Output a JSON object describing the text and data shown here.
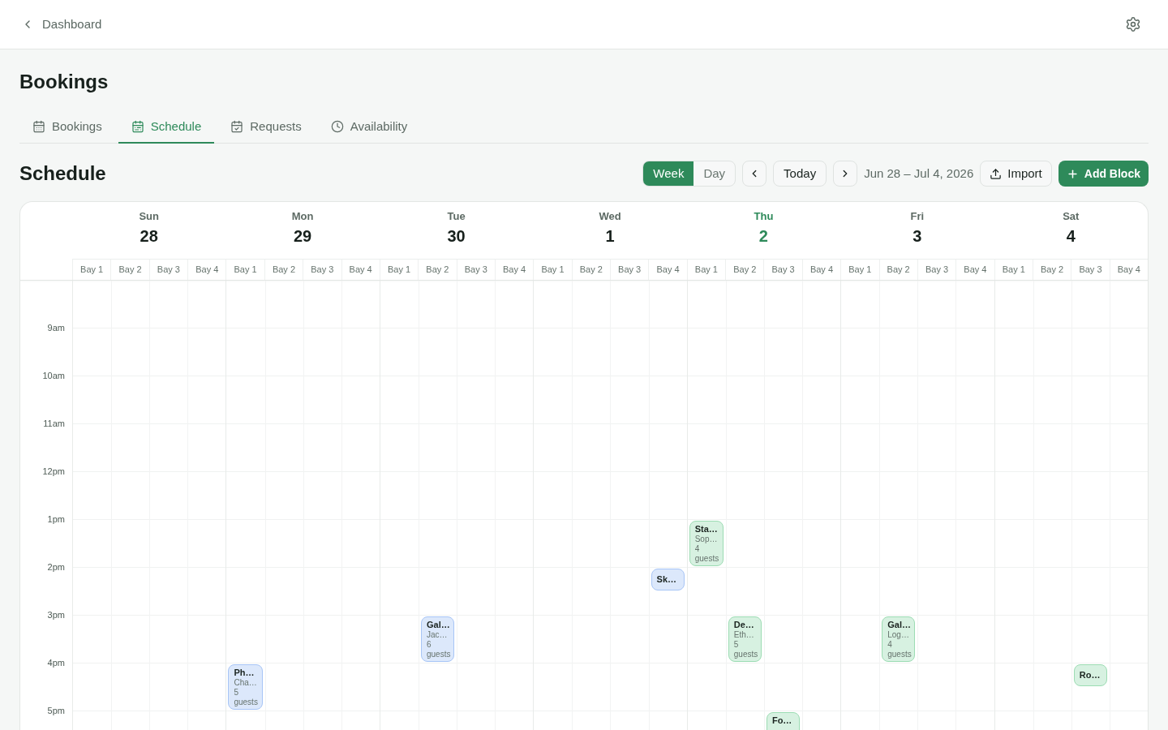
{
  "header": {
    "back_label": "Dashboard"
  },
  "page_title": "Bookings",
  "tabs": [
    {
      "label": "Bookings",
      "kind": "calendar",
      "selected": false
    },
    {
      "label": "Schedule",
      "kind": "schedule",
      "selected": true
    },
    {
      "label": "Requests",
      "kind": "requests",
      "selected": false
    },
    {
      "label": "Availability",
      "kind": "availability",
      "selected": false
    }
  ],
  "schedule": {
    "title": "Schedule",
    "views": [
      {
        "label": "Week",
        "selected": true
      },
      {
        "label": "Day",
        "selected": false
      }
    ],
    "today_button": "Today",
    "date_range": "Jun 28 – Jul 4, 2026",
    "import_button": "Import",
    "add_button": "Add Block"
  },
  "calendar": {
    "hours": [
      "9am",
      "10am",
      "11am",
      "12pm",
      "1pm",
      "2pm",
      "3pm",
      "4pm",
      "5pm"
    ],
    "days": [
      {
        "name": "Sun",
        "date": "28",
        "today": false,
        "bays": [
          {
            "label": "Bay 1"
          },
          {
            "label": "Bay 2"
          },
          {
            "label": "Bay 3"
          },
          {
            "label": "Bay 4"
          }
        ]
      },
      {
        "name": "Mon",
        "date": "29",
        "today": false,
        "bays": [
          {
            "label": "Bay 1",
            "slots": [
              {
                "kind": "free"
              },
              {
                "kind": "free"
              },
              {
                "kind": "free"
              },
              {
                "kind": "free"
              },
              {
                "kind": "free"
              },
              {
                "kind": "free"
              },
              {
                "kind": "free"
              },
              {
                "kind": "free"
              },
              {
                "kind": "full",
                "title": "Ph…",
                "subtitle": "Cha…",
                "guests": "5 guests",
                "color": "#a7c5f6"
              }
            ]
          },
          {
            "label": "Bay 2"
          },
          {
            "label": "Bay 3"
          },
          {
            "label": "Bay 4"
          }
        ]
      },
      {
        "name": "Tue",
        "date": "30",
        "today": false,
        "bays": [
          {
            "label": "Bay 1"
          },
          {
            "label": "Bay 2",
            "slots": [
              {
                "kind": "free"
              },
              {
                "kind": "free"
              },
              {
                "kind": "free"
              },
              {
                "kind": "free"
              },
              {
                "kind": "free"
              },
              {
                "kind": "free"
              },
              {
                "kind": "free"
              },
              {
                "kind": "full",
                "title": "Gal…",
                "subtitle": "Jac…",
                "guests": "6 guests",
                "color": "#a7c5f6"
              }
            ]
          },
          {
            "label": "Bay 3"
          },
          {
            "label": "Bay 4"
          }
        ]
      },
      {
        "name": "Wed",
        "date": "1",
        "today": false,
        "bays": [
          {
            "label": "Bay 1"
          },
          {
            "label": "Bay 2"
          },
          {
            "label": "Bay 3"
          },
          {
            "label": "Bay 4",
            "slots": [
              {
                "kind": "free"
              },
              {
                "kind": "free"
              },
              {
                "kind": "free"
              },
              {
                "kind": "free"
              },
              {
                "kind": "free"
              },
              {
                "kind": "free"
              },
              {
                "kind": "half",
                "title": "Sk…",
                "color": "#a7c5f6"
              }
            ]
          }
        ]
      },
      {
        "name": "Thu",
        "date": "2",
        "today": true,
        "bays": [
          {
            "label": "Bay 1",
            "slots": [
              {
                "kind": "free"
              },
              {
                "kind": "free"
              },
              {
                "kind": "free"
              },
              {
                "kind": "free"
              },
              {
                "kind": "free"
              },
              {
                "kind": "full",
                "title": "Sta…",
                "subtitle": "Sop…",
                "guests": "4 guests",
                "color": "#9cdcb3"
              }
            ]
          },
          {
            "label": "Bay 2",
            "slots": [
              {
                "kind": "free"
              },
              {
                "kind": "free"
              },
              {
                "kind": "free"
              },
              {
                "kind": "free"
              },
              {
                "kind": "free"
              },
              {
                "kind": "free"
              },
              {
                "kind": "free"
              },
              {
                "kind": "full",
                "title": "De…",
                "subtitle": "Eth…",
                "guests": "5 guests",
                "color": "#9cdcb3"
              }
            ]
          },
          {
            "label": "Bay 3",
            "slots": [
              {
                "kind": "free"
              },
              {
                "kind": "free"
              },
              {
                "kind": "free"
              },
              {
                "kind": "free"
              },
              {
                "kind": "free"
              },
              {
                "kind": "free"
              },
              {
                "kind": "free"
              },
              {
                "kind": "free"
              },
              {
                "kind": "free"
              },
              {
                "kind": "full",
                "title": "Fo…",
                "color": "#9cdcb3"
              }
            ]
          },
          {
            "label": "Bay 4"
          }
        ]
      },
      {
        "name": "Fri",
        "date": "3",
        "today": false,
        "bays": [
          {
            "label": "Bay 1"
          },
          {
            "label": "Bay 2",
            "slots": [
              {
                "kind": "free"
              },
              {
                "kind": "free"
              },
              {
                "kind": "free"
              },
              {
                "kind": "free"
              },
              {
                "kind": "free"
              },
              {
                "kind": "free"
              },
              {
                "kind": "free"
              },
              {
                "kind": "full",
                "title": "Gal…",
                "subtitle": "Log…",
                "guests": "4 guests",
                "color": "#9cdcb3"
              }
            ]
          },
          {
            "label": "Bay 3"
          },
          {
            "label": "Bay 4"
          }
        ]
      },
      {
        "name": "Sat",
        "date": "4",
        "today": false,
        "bays": [
          {
            "label": "Bay 1"
          },
          {
            "label": "Bay 2"
          },
          {
            "label": "Bay 3",
            "slots": [
              {
                "kind": "free"
              },
              {
                "kind": "free"
              },
              {
                "kind": "free"
              },
              {
                "kind": "free"
              },
              {
                "kind": "free"
              },
              {
                "kind": "free"
              },
              {
                "kind": "free"
              },
              {
                "kind": "free"
              },
              {
                "kind": "half",
                "title": "Ro…",
                "color": "#9cdcb3"
              }
            ]
          },
          {
            "label": "Bay 4"
          }
        ]
      }
    ]
  }
}
